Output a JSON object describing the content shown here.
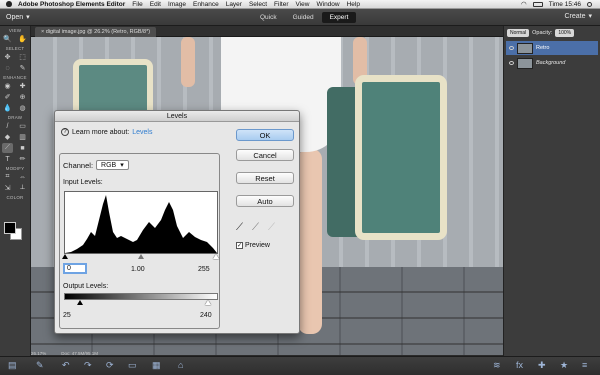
{
  "mac_menu": {
    "app_name": "Adobe Photoshop Elements Editor",
    "items": [
      "File",
      "Edit",
      "Image",
      "Enhance",
      "Layer",
      "Select",
      "Filter",
      "View",
      "Window",
      "Help"
    ],
    "clock": "Time 15:46"
  },
  "topbar": {
    "open_label": "Open",
    "modes": [
      "Quick",
      "Guided",
      "Expert"
    ],
    "active_mode": "Expert",
    "create_label": "Create"
  },
  "toolbar": {
    "sections": [
      "VIEW",
      "SELECT",
      "ENHANCE",
      "DRAW",
      "MODIFY",
      "COLOR"
    ]
  },
  "document_tab": {
    "label": "digital image.jpg @ 26.2% (Retro, RGB/8*)"
  },
  "layers_panel": {
    "blend_mode": "Normal",
    "opacity_label": "Opacity:",
    "opacity_value": "100%",
    "layers": [
      {
        "name": "Retro",
        "selected": true
      },
      {
        "name": "Background",
        "selected": false
      }
    ]
  },
  "status_bar": {
    "zoom": "26.17%",
    "doc": "Doc: 47.5M/95.1M"
  },
  "levels_dialog": {
    "title": "Levels",
    "learn_more_prefix": "Learn more about:",
    "learn_more_link": "Levels",
    "channel_label": "Channel:",
    "channel_value": "RGB",
    "input_levels_label": "Input Levels:",
    "input_black": "0",
    "input_gamma": "1.00",
    "input_white": "255",
    "output_levels_label": "Output Levels:",
    "output_black": "25",
    "output_white": "240",
    "buttons": {
      "ok": "OK",
      "cancel": "Cancel",
      "reset": "Reset",
      "auto": "Auto"
    },
    "preview_label": "Preview",
    "preview_checked": true
  },
  "colors": {
    "accent_blue": "#2f7ccf",
    "selected_layer": "#4b6fa8"
  }
}
